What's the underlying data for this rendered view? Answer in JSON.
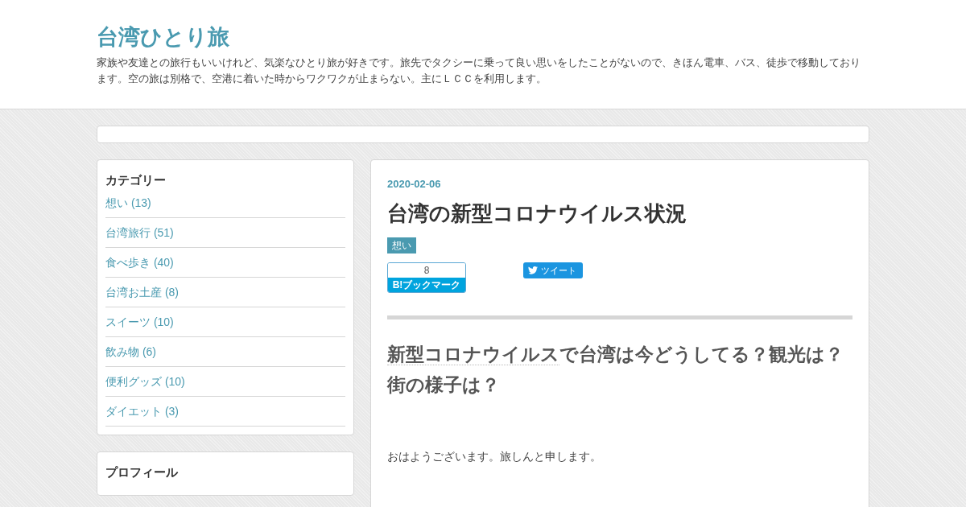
{
  "blog": {
    "title": "台湾ひとり旅",
    "description": "家族や友達との旅行もいいけれど、気楽なひとり旅が好きです。旅先でタクシーに乗って良い思いをしたことがないので、きほん電車、バス、徒歩で移動しております。空の旅は別格で、空港に着いた時からワクワクが止まらない。主にＬＣＣを利用します。"
  },
  "sidebar": {
    "categories": {
      "title": "カテゴリー",
      "items": [
        {
          "label": "想い (13)"
        },
        {
          "label": "台湾旅行 (51)"
        },
        {
          "label": "食べ歩き (40)"
        },
        {
          "label": "台湾お土産 (8)"
        },
        {
          "label": "スイーツ (10)"
        },
        {
          "label": "飲み物 (6)"
        },
        {
          "label": "便利グッズ (10)"
        },
        {
          "label": "ダイエット (3)"
        }
      ]
    },
    "profile": {
      "title": "プロフィール"
    }
  },
  "article": {
    "date": "2020-02-06",
    "title": "台湾の新型コロナウイルス状況",
    "category": "想い",
    "bookmark": {
      "count": "8",
      "label": "B!ブックマーク"
    },
    "tweet": "ツイート",
    "heading": {
      "link": "新型コロナウイルス",
      "rest": "で台湾は今どうしてる？観光は？街の様子は？"
    },
    "body": "おはようございます。旅しんと申します。"
  }
}
